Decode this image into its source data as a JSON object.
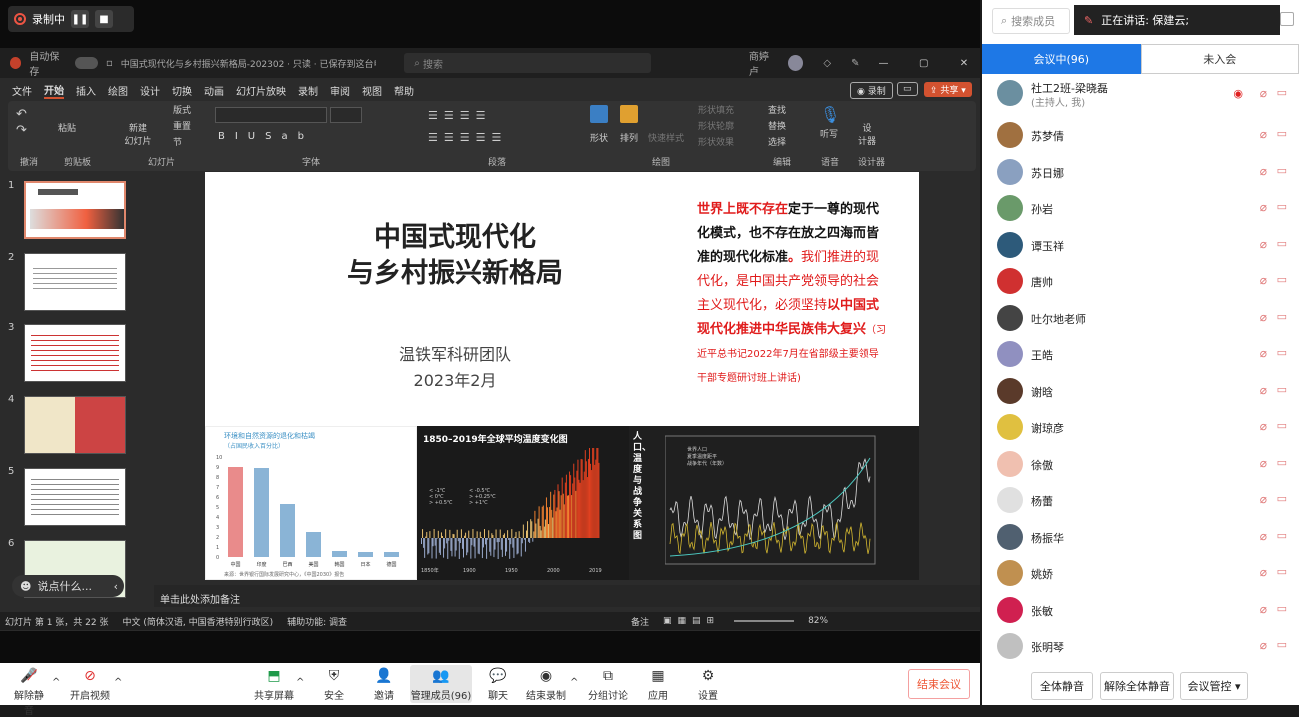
{
  "recording": {
    "label": "录制中"
  },
  "ppt": {
    "autosave": "自动保存",
    "autosave_state": "关",
    "title": "中国式现代化与乡村振兴新格局-202302 · 只读 · 已保存到这台电脑",
    "search": "搜索",
    "user": "商婷 卢",
    "menu": [
      "文件",
      "开始",
      "插入",
      "绘图",
      "设计",
      "切换",
      "动画",
      "幻灯片放映",
      "录制",
      "审阅",
      "视图",
      "帮助"
    ],
    "record_btn": "录制",
    "share_btn": "共享",
    "ribbon_groups": [
      "撤消",
      "剪贴板",
      "幻灯片",
      "字体",
      "段落",
      "绘图",
      "编辑",
      "语音",
      "设计器"
    ],
    "ribbon_items": {
      "paste": "粘贴",
      "new_slide": "新建\n幻灯片",
      "layout": "版式",
      "reset": "重置",
      "section": "节",
      "shape": "形状",
      "arrange": "排列",
      "quick_style": "快速样式",
      "find": "查找",
      "replace": "替换",
      "select": "选择",
      "dictate": "听写",
      "designer": "设\n计器",
      "shape_fill": "形状填充",
      "shape_outline": "形状轮廓",
      "shape_effect": "形状效果"
    },
    "thumb_numbers": [
      "1",
      "2",
      "3",
      "4",
      "5",
      "6"
    ],
    "comment_bubble": "说点什么...",
    "notes": "单击此处添加备注",
    "status": {
      "slide": "幻灯片 第 1 张，共 22 张",
      "lang": "中文 (简体汉语, 中国香港特别行政区)",
      "accessibility": "辅助功能: 调查",
      "notes_btn": "备注",
      "zoom": "82%"
    }
  },
  "slide": {
    "title_line1": "中国式现代化",
    "title_line2": "与乡村振兴新格局",
    "team": "温铁军科研团队",
    "date": "2023年2月",
    "quote": {
      "p1_red": "世界上",
      "p1_red2": "既不存在",
      "p1_black": "定于一尊的现代化模式，也不存在放之四海而皆准的现代化标准",
      "p1_end": "。",
      "p2_red": "我们推进的现代化，是中国共产党领导的社会主义现代化，必须坚持",
      "p2_bold": "以中国式现代化推进中华民族伟大复兴",
      "p2_src": "（习近平总书记2022年7月在省部级主要领导干部专题研讨班上讲话)"
    },
    "chart1_title": "环境和自然资源的退化和枯竭",
    "chart1_sub": "（占国民收入百分比）",
    "chart1_note": "来源：世界银行国际发展研究中心，《中国2030》报告",
    "chart2_title": "1850–2019年全球平均温度变化图",
    "chart2_legend": [
      "< -1℃",
      "< -0.5℃",
      "< 0℃",
      "> +0.25℃",
      "> +0.5℃",
      "> +1℃"
    ],
    "chart2_x": [
      "1850年",
      "1900",
      "1950",
      "2000",
      "2019"
    ],
    "chart3_side": "人口、温度与战争关系图",
    "chart3_legend": [
      "世界人口",
      "夏季温度距平",
      "战争年代（年数）"
    ]
  },
  "chart_data": [
    {
      "type": "bar",
      "title": "环境和自然资源的退化和枯竭",
      "subtitle": "（占国民收入百分比）",
      "categories": [
        "中国",
        "印度",
        "巴西",
        "美国",
        "韩国",
        "日本",
        "德国"
      ],
      "values": [
        9,
        8.9,
        5.3,
        2.5,
        0.6,
        0.5,
        0.5
      ],
      "ylim": [
        0,
        10
      ],
      "colors": [
        "#e98b8b",
        "#8ab4d6",
        "#8ab4d6",
        "#8ab4d6",
        "#8ab4d6",
        "#8ab4d6",
        "#8ab4d6"
      ]
    }
  ],
  "toolbar": {
    "mute": "解除静音",
    "video": "开启视频",
    "share": "共享屏幕",
    "safe": "安全",
    "invite": "邀请",
    "members": "管理成员(96)",
    "chat": "聊天",
    "record": "结束录制",
    "breakout": "分组讨论",
    "apps": "应用",
    "settings": "设置",
    "end": "结束会议"
  },
  "panel": {
    "search": "搜索成员",
    "speaking": "正在讲话: 保建云;",
    "tab_in": "会议中(96)",
    "tab_out": "未入会",
    "host_name": "社工2班-梁晓磊",
    "host_role": "(主持人, 我)",
    "members": [
      "苏梦倩",
      "苏日娜",
      "孙岩",
      "谭玉祥",
      "唐帅",
      "吐尔地老师",
      "王皓",
      "谢晗",
      "谢琼彦",
      "徐傲",
      "杨蕾",
      "杨振华",
      "姚娇",
      "张敏",
      "张明琴"
    ],
    "mute_all": "全体静音",
    "unmute_all": "解除全体静音",
    "manage": "会议管控"
  }
}
